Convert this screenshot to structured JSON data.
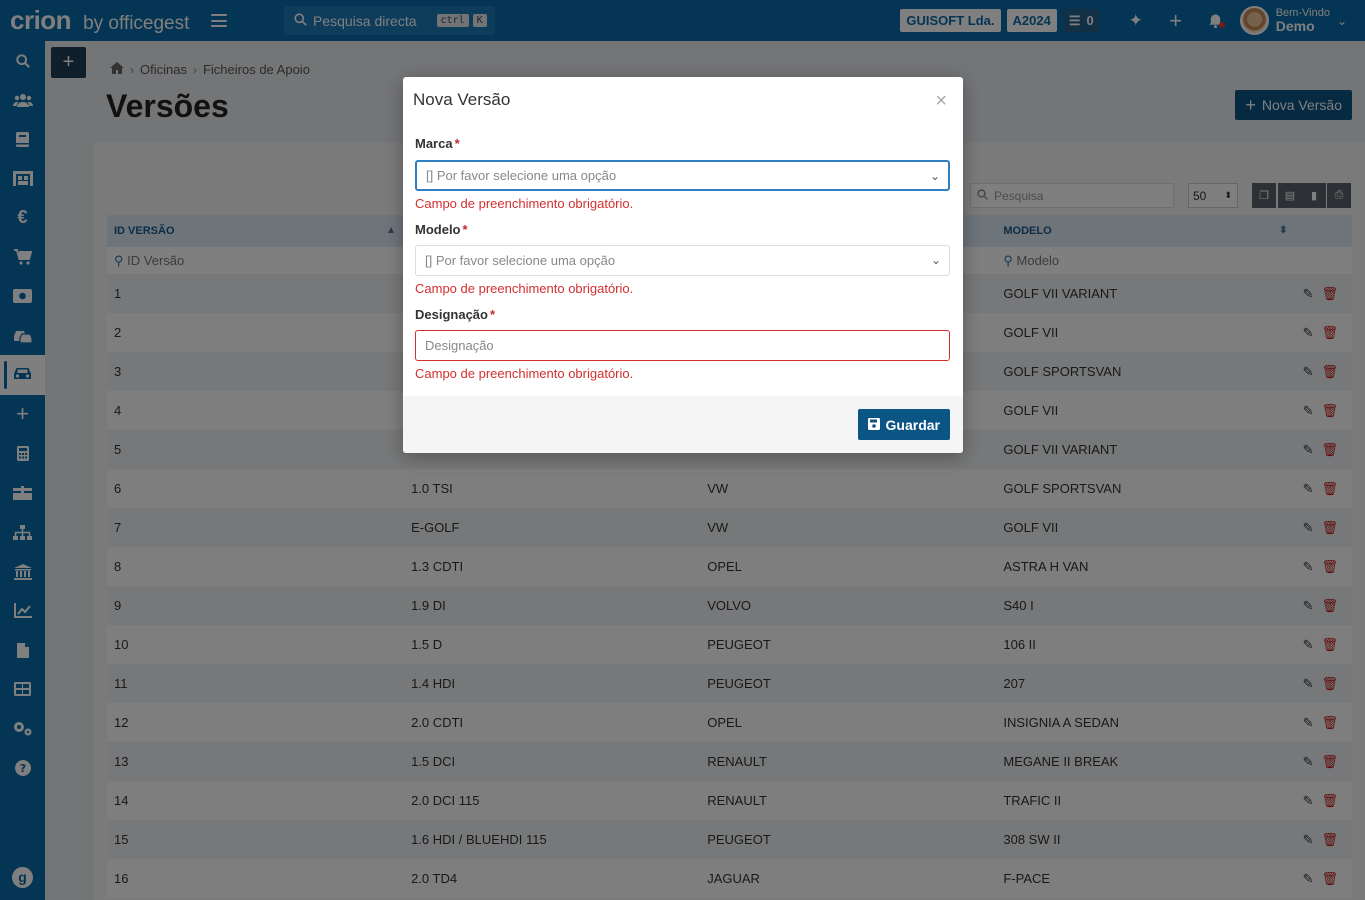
{
  "header": {
    "brand": "crion",
    "by": "by officegest",
    "search": {
      "label": "Pesquisa directa",
      "kbd1": "ctrl",
      "kbd2": "K"
    },
    "company": "GUISOFT Lda.",
    "year": "A2024",
    "tasks_count": "0",
    "user": {
      "greeting": "Bem-Vindo",
      "name": "Demo"
    }
  },
  "sidebar": {
    "icons": [
      "search-icon",
      "users-icon",
      "book-icon",
      "warehouse-icon",
      "euro-icon",
      "cart-icon",
      "cash-icon",
      "car-wash-icon",
      "car-icon",
      "plus-icon",
      "calculator-icon",
      "boxes-icon",
      "sitemap-icon",
      "bank-icon",
      "chart-icon",
      "file-icon",
      "table-icon",
      "settings-icon",
      "help-icon"
    ]
  },
  "breadcrumb": {
    "level1": "Oficinas",
    "level2": "Ficheiros de Apoio"
  },
  "page": {
    "title": "Versões",
    "new_button": "Nova Versão"
  },
  "table": {
    "search_placeholder": "Pesquisa",
    "per_page": "50",
    "columns": {
      "id": "ID VERSÃO",
      "model": "MODELO"
    },
    "filters": {
      "id": "ID Versão",
      "model": "Modelo"
    },
    "rows": [
      {
        "id": "1",
        "version": "",
        "brand": "",
        "model": "GOLF VII VARIANT"
      },
      {
        "id": "2",
        "version": "",
        "brand": "",
        "model": "GOLF VII"
      },
      {
        "id": "3",
        "version": "",
        "brand": "",
        "model": "GOLF SPORTSVAN"
      },
      {
        "id": "4",
        "version": "",
        "brand": "",
        "model": "GOLF VII"
      },
      {
        "id": "5",
        "version": "",
        "brand": "",
        "model": "GOLF VII VARIANT"
      },
      {
        "id": "6",
        "version": "1.0 TSI",
        "brand": "VW",
        "model": "GOLF SPORTSVAN"
      },
      {
        "id": "7",
        "version": "E-GOLF",
        "brand": "VW",
        "model": "GOLF VII"
      },
      {
        "id": "8",
        "version": "1.3 CDTI",
        "brand": "OPEL",
        "model": "ASTRA H VAN"
      },
      {
        "id": "9",
        "version": "1.9 DI",
        "brand": "VOLVO",
        "model": "S40 I"
      },
      {
        "id": "10",
        "version": "1.5 D",
        "brand": "PEUGEOT",
        "model": "106 II"
      },
      {
        "id": "11",
        "version": "1.4 HDI",
        "brand": "PEUGEOT",
        "model": "207"
      },
      {
        "id": "12",
        "version": "2.0 CDTI",
        "brand": "OPEL",
        "model": "INSIGNIA A SEDAN"
      },
      {
        "id": "13",
        "version": "1.5 DCI",
        "brand": "RENAULT",
        "model": "MEGANE II BREAK"
      },
      {
        "id": "14",
        "version": "2.0 DCI 115",
        "brand": "RENAULT",
        "model": "TRAFIC II"
      },
      {
        "id": "15",
        "version": "1.6 HDI / BLUEHDI 115",
        "brand": "PEUGEOT",
        "model": "308 SW II"
      },
      {
        "id": "16",
        "version": "2.0 TD4",
        "brand": "JAGUAR",
        "model": "F-PACE"
      }
    ]
  },
  "modal": {
    "title": "Nova Versão",
    "close": "×",
    "marca": {
      "label": "Marca",
      "placeholder": "[] Por favor selecione uma opção",
      "error": "Campo de preenchimento obrigatório."
    },
    "modelo": {
      "label": "Modelo",
      "placeholder": "[] Por favor selecione uma opção",
      "error": "Campo de preenchimento obrigatório."
    },
    "designacao": {
      "label": "Designação",
      "placeholder": "Designação",
      "error": "Campo de preenchimento obrigatório."
    },
    "required_mark": "*",
    "save": "Guardar"
  }
}
